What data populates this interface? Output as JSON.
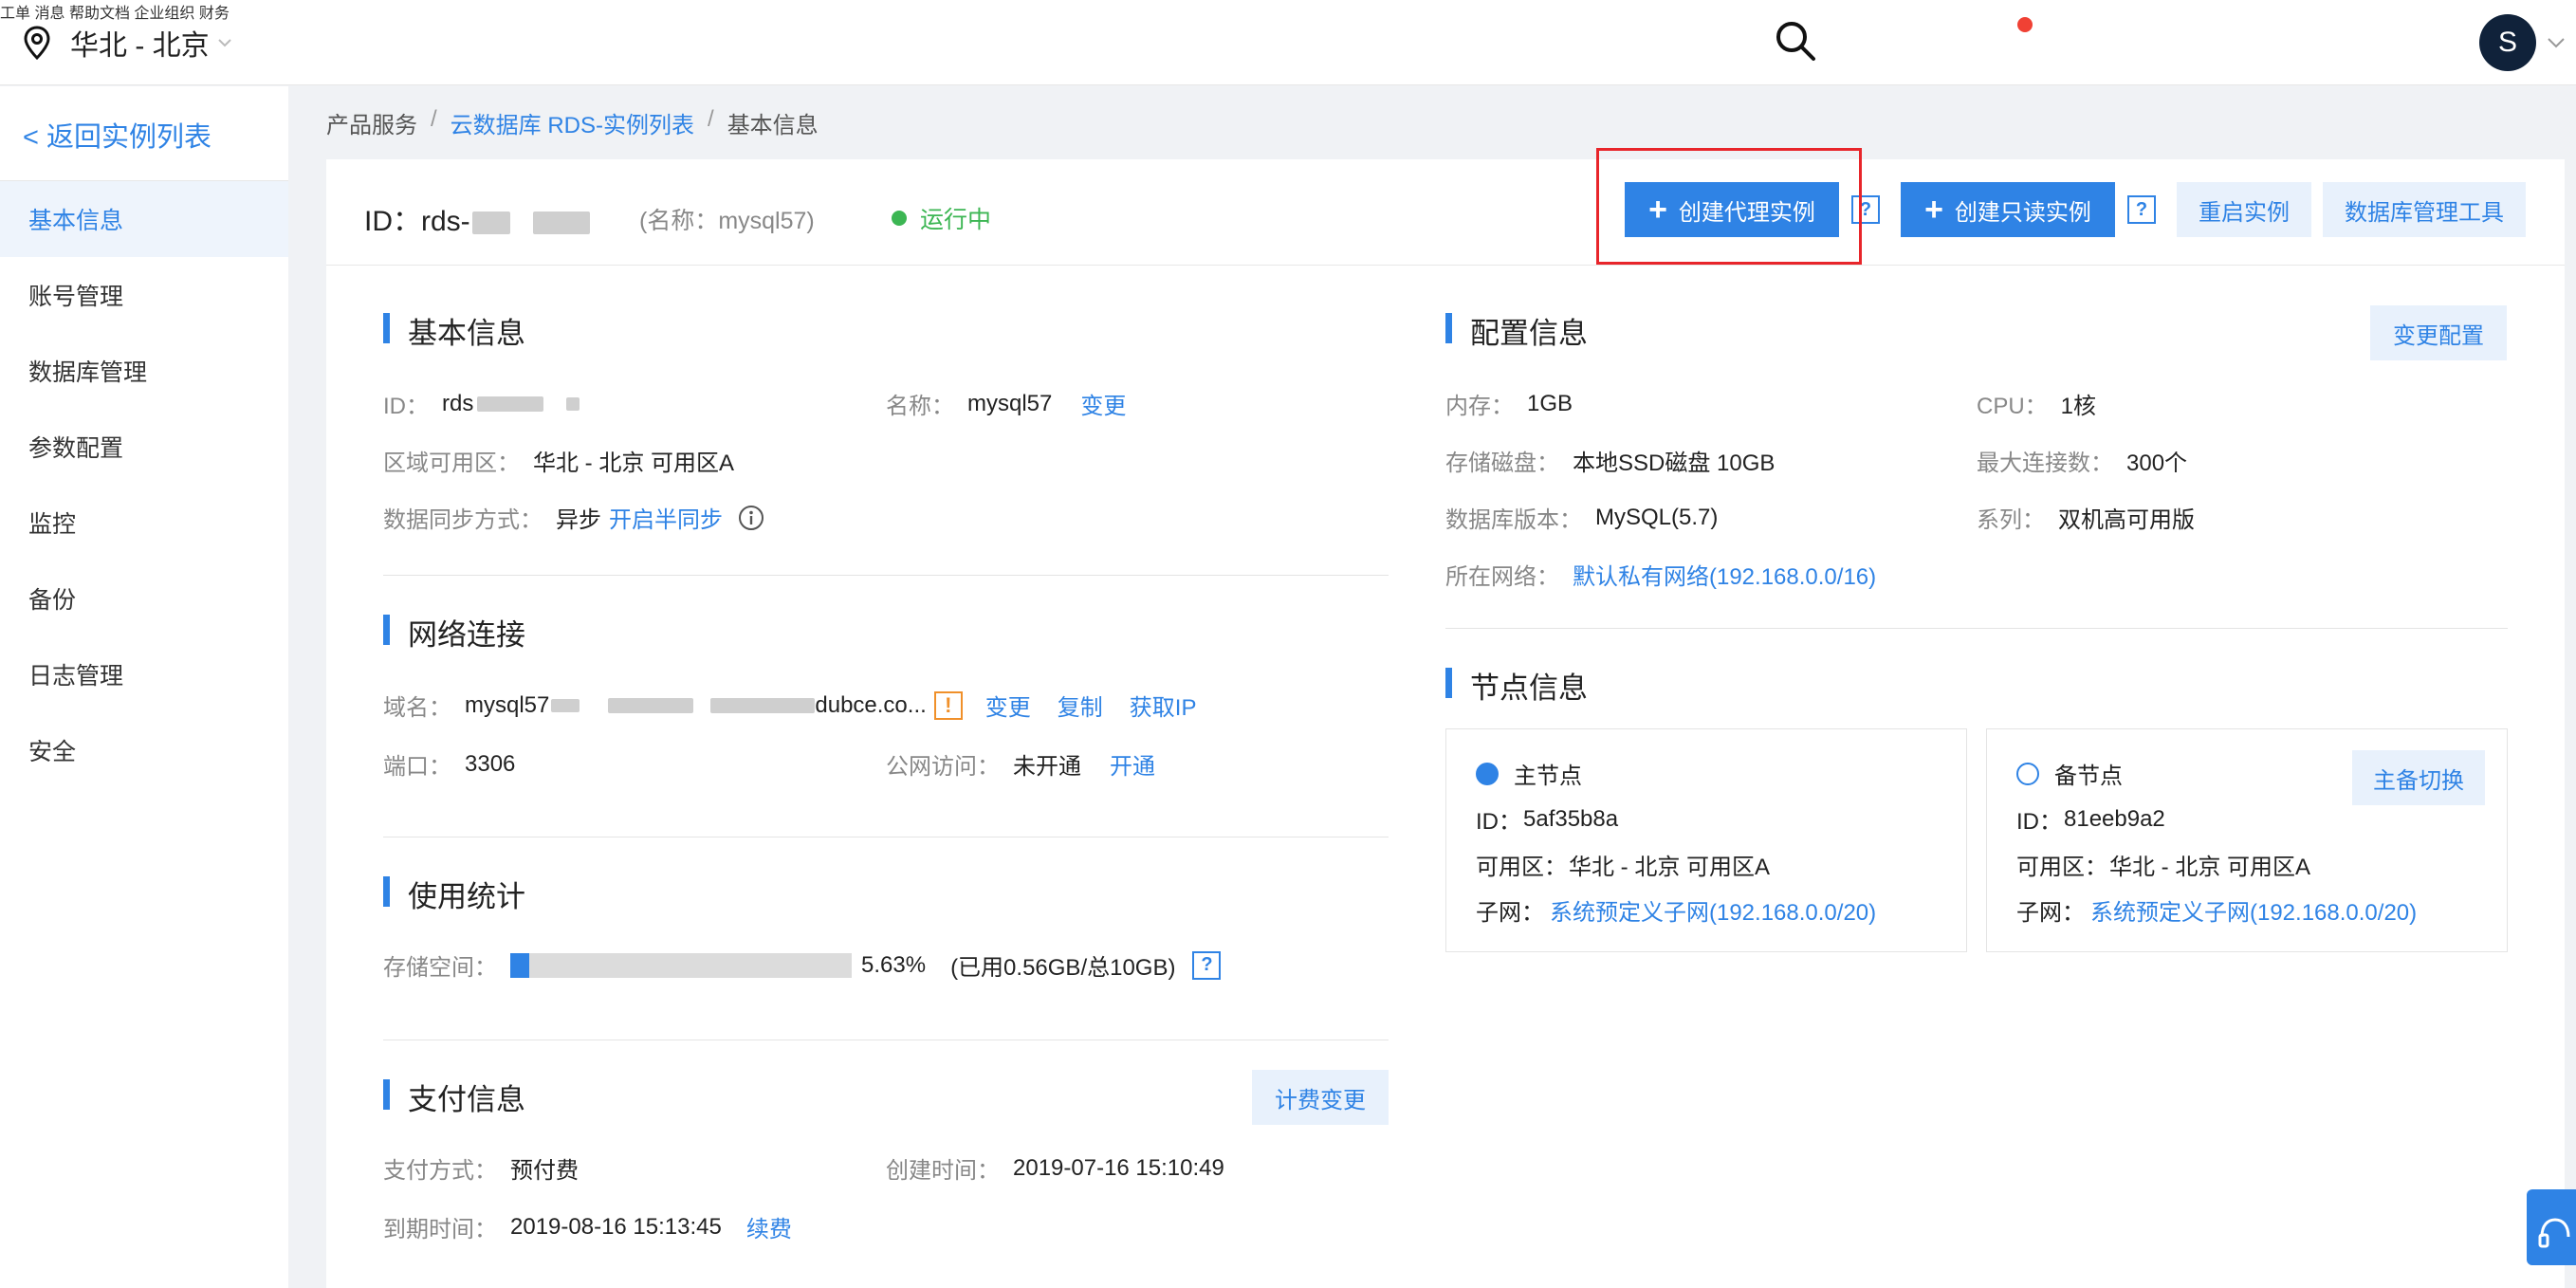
{
  "topbar": {
    "region": "华北 - 北京",
    "nav": [
      "工单",
      "消息",
      "帮助文档",
      "企业组织",
      "财务"
    ],
    "avatar_letter": "S"
  },
  "sidebar": {
    "back": "< 返回实例列表",
    "items": [
      "基本信息",
      "账号管理",
      "数据库管理",
      "参数配置",
      "监控",
      "备份",
      "日志管理",
      "安全"
    ]
  },
  "breadcrumb": {
    "root": "产品服务",
    "sep": "/",
    "list": "云数据库 RDS-实例列表",
    "current": "基本信息"
  },
  "header": {
    "id_label": "ID：",
    "id_value": "rds-",
    "name": "(名称：mysql57)",
    "status": "运行中",
    "btn_proxy": "创建代理实例",
    "btn_readonly": "创建只读实例",
    "btn_restart": "重启实例",
    "btn_dbtool": "数据库管理工具",
    "q": "?",
    "plus": "+"
  },
  "basic": {
    "title": "基本信息",
    "id_k": "ID：",
    "id_v": "rds",
    "name_k": "名称：",
    "name_v": "mysql57",
    "name_change": "变更",
    "zone_k": "区域可用区：",
    "zone_v": "华北 - 北京 可用区A",
    "sync_k": "数据同步方式：",
    "sync_v": "异步",
    "sync_link": "开启半同步"
  },
  "network": {
    "title": "网络连接",
    "domain_k": "域名：",
    "domain_prefix": "mysql57",
    "domain_suffix": "dubce.co...",
    "warn": "!",
    "change": "变更",
    "copy": "复制",
    "getip": "获取IP",
    "port_k": "端口：",
    "port_v": "3306",
    "public_k": "公网访问：",
    "public_v": "未开通",
    "public_link": "开通"
  },
  "usage": {
    "title": "使用统计",
    "storage_k": "存储空间：",
    "percent": "5.63%",
    "percent_value": 5.63,
    "detail": "(已用0.56GB/总10GB)",
    "q": "?"
  },
  "payment": {
    "title": "支付信息",
    "btn": "计费变更",
    "method_k": "支付方式：",
    "method_v": "预付费",
    "created_k": "创建时间：",
    "created_v": "2019-07-16 15:10:49",
    "expire_k": "到期时间：",
    "expire_v": "2019-08-16 15:13:45",
    "renew": "续费"
  },
  "config": {
    "title": "配置信息",
    "btn": "变更配置",
    "mem_k": "内存：",
    "mem_v": "1GB",
    "cpu_k": "CPU：",
    "cpu_v": "1核",
    "disk_k": "存储磁盘：",
    "disk_v": "本地SSD磁盘 10GB",
    "maxconn_k": "最大连接数：",
    "maxconn_v": "300个",
    "ver_k": "数据库版本：",
    "ver_v": "MySQL(5.7)",
    "series_k": "系列：",
    "series_v": "双机高可用版",
    "net_k": "所在网络：",
    "net_v": "默认私有网络(192.168.0.0/16)"
  },
  "nodes": {
    "title": "节点信息",
    "primary": {
      "label": "主节点",
      "id_k": "ID：",
      "id_v": "5af35b8a",
      "zone_k": "可用区：",
      "zone_v": "华北 - 北京 可用区A",
      "subnet_k": "子网：",
      "subnet_v": "系统预定义子网(192.168.0.0/20)"
    },
    "standby": {
      "label": "备节点",
      "switch": "主备切换",
      "id_k": "ID：",
      "id_v": "81eeb9a2",
      "zone_k": "可用区：",
      "zone_v": "华北 - 北京 可用区A",
      "subnet_k": "子网：",
      "subnet_v": "系统预定义子网(192.168.0.0/20)"
    }
  },
  "colors": {
    "accent": "#2f83e5",
    "running": "#3cb653",
    "highlight": "#e8252a",
    "warn": "#f0902a"
  }
}
